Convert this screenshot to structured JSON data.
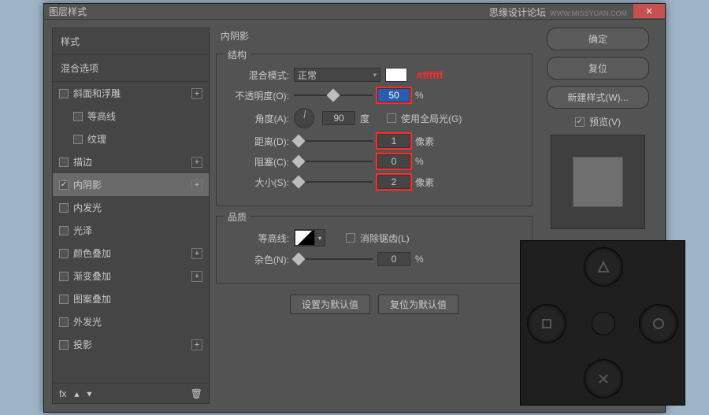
{
  "window": {
    "title": "图层样式"
  },
  "watermark": {
    "text": "思缘设计论坛",
    "sub": "WWW.MISSYUAN.COM"
  },
  "sidebar": {
    "head1": "样式",
    "head2": "混合选项",
    "items": [
      {
        "label": "斜面和浮雕",
        "checked": false,
        "plus": true,
        "indent": false
      },
      {
        "label": "等高线",
        "checked": false,
        "plus": false,
        "indent": true
      },
      {
        "label": "纹理",
        "checked": false,
        "plus": false,
        "indent": true
      },
      {
        "label": "描边",
        "checked": false,
        "plus": true,
        "indent": false
      },
      {
        "label": "内阴影",
        "checked": true,
        "plus": true,
        "indent": false,
        "selected": true
      },
      {
        "label": "内发光",
        "checked": false,
        "plus": false,
        "indent": false
      },
      {
        "label": "光泽",
        "checked": false,
        "plus": false,
        "indent": false
      },
      {
        "label": "颜色叠加",
        "checked": false,
        "plus": true,
        "indent": false
      },
      {
        "label": "渐变叠加",
        "checked": false,
        "plus": true,
        "indent": false
      },
      {
        "label": "图案叠加",
        "checked": false,
        "plus": false,
        "indent": false
      },
      {
        "label": "外发光",
        "checked": false,
        "plus": false,
        "indent": false
      },
      {
        "label": "投影",
        "checked": false,
        "plus": true,
        "indent": false
      }
    ],
    "foot": {
      "fx": "fx",
      "trash": "🗑"
    }
  },
  "main": {
    "title": "内阴影",
    "structure": {
      "legend": "结构",
      "blend_label": "混合模式:",
      "blend_value": "正常",
      "color_annot": "#ffffff",
      "opacity_label": "不透明度(O):",
      "opacity_value": "50",
      "opacity_unit": "%",
      "angle_label": "角度(A):",
      "angle_value": "90",
      "angle_unit": "度",
      "global_label": "使用全局光(G)",
      "global_checked": false,
      "distance_label": "距离(D):",
      "distance_value": "1",
      "distance_unit": "像素",
      "choke_label": "阻塞(C):",
      "choke_value": "0",
      "choke_unit": "%",
      "size_label": "大小(S):",
      "size_value": "2",
      "size_unit": "像素"
    },
    "quality": {
      "legend": "品质",
      "contour_label": "等高线:",
      "aa_label": "消除锯齿(L)",
      "aa_checked": false,
      "noise_label": "杂色(N):",
      "noise_value": "0",
      "noise_unit": "%"
    },
    "buttons": {
      "default": "设置为默认值",
      "reset": "复位为默认值"
    }
  },
  "right": {
    "ok": "确定",
    "cancel": "复位",
    "newstyle": "新建样式(W)...",
    "preview": "预览(V)",
    "preview_checked": true
  }
}
